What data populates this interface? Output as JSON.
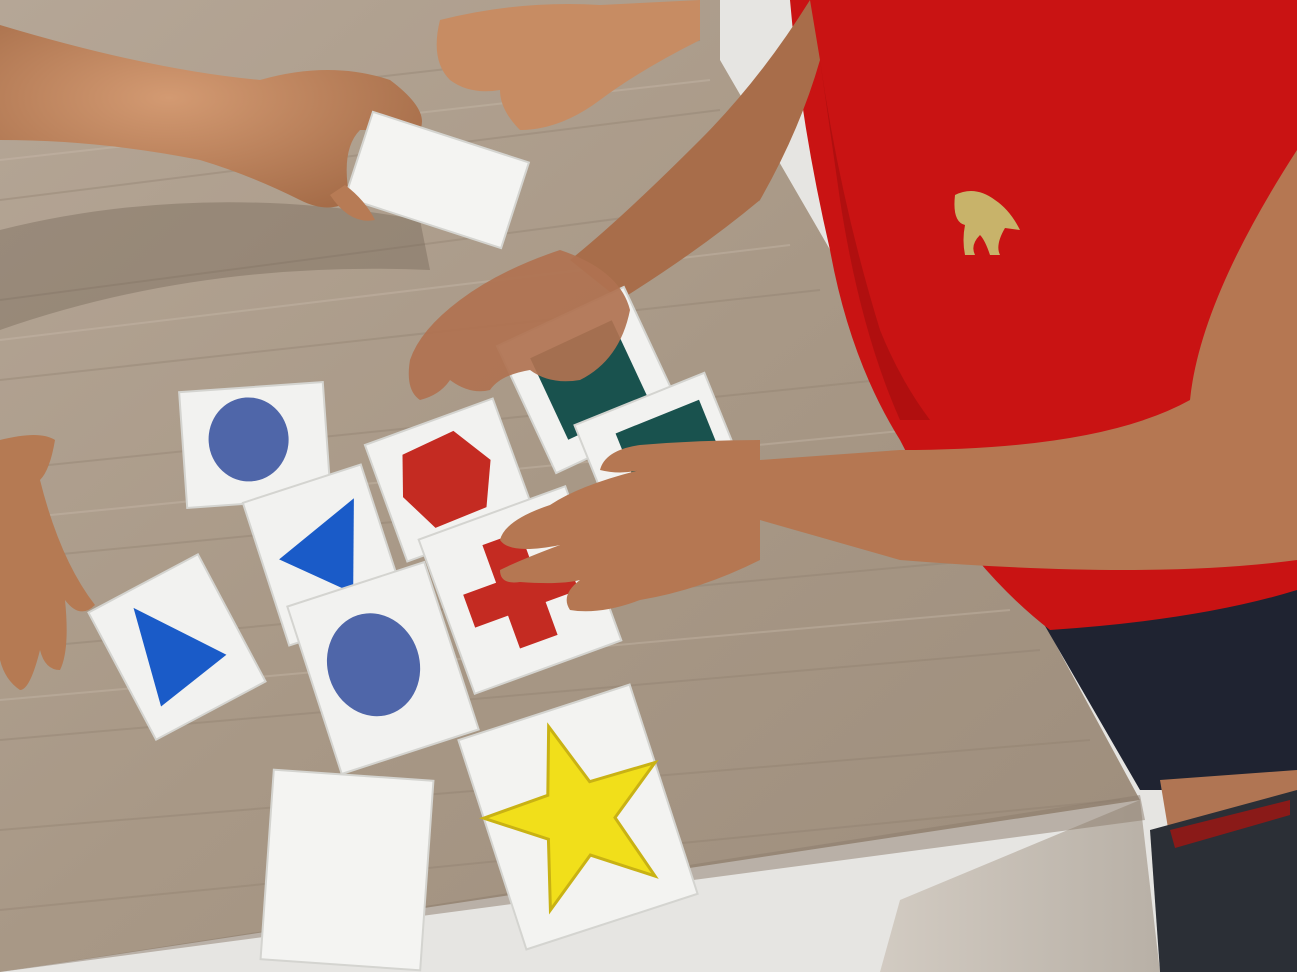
{
  "scene": {
    "colors": {
      "table_light": "#b9ab9b",
      "table_mid": "#a39380",
      "table_dark": "#7d6f61",
      "table_side": "#cbc3b8",
      "floor": "#e3e3e1",
      "card_white": "#f3f3f1",
      "card_edge": "#d4d4d0",
      "shirt_red": "#cc1414",
      "shirt_shadow": "#9e0d0d",
      "skin": "#c68a63",
      "skin_dark": "#8e5a3c",
      "shorts": "#1e2230",
      "blue": "#1a5bc8",
      "periwinkle": "#4f66a9",
      "red_shape": "#c42b22",
      "teal": "#19524e",
      "yellow": "#f1df1a",
      "emblem": "#c8b36a"
    },
    "cards": [
      {
        "shape": "circle",
        "color": "periwinkle"
      },
      {
        "shape": "triangle",
        "color": "blue"
      },
      {
        "shape": "triangle",
        "color": "blue"
      },
      {
        "shape": "circle",
        "color": "periwinkle"
      },
      {
        "shape": "hexagon",
        "color": "red_shape"
      },
      {
        "shape": "square",
        "color": "teal"
      },
      {
        "shape": "square",
        "color": "teal"
      },
      {
        "shape": "cross",
        "color": "red_shape"
      },
      {
        "shape": "star",
        "color": "yellow"
      },
      {
        "shape": "blank",
        "color": "card_white"
      },
      {
        "shape": "blank",
        "color": "card_white"
      }
    ]
  }
}
